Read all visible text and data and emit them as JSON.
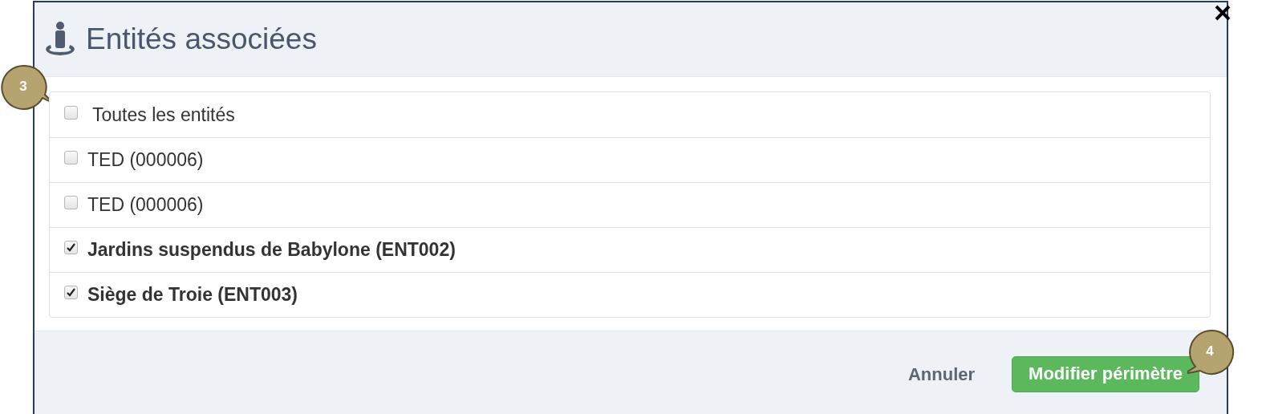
{
  "dialog": {
    "title": "Entités associées"
  },
  "entities": [
    {
      "label": "Toutes les entités",
      "checked": false
    },
    {
      "label": "TED (000006)",
      "checked": false
    },
    {
      "label": "TED (000006)",
      "checked": false
    },
    {
      "label": "Jardins suspendus de Babylone (ENT002)",
      "checked": true
    },
    {
      "label": "Siège de Troie (ENT003)",
      "checked": true
    }
  ],
  "buttons": {
    "cancel": "Annuler",
    "submit": "Modifier périmètre"
  },
  "callouts": [
    {
      "number": "3",
      "kind": "tail_right"
    },
    {
      "number": "4",
      "kind": "tail_left"
    }
  ]
}
